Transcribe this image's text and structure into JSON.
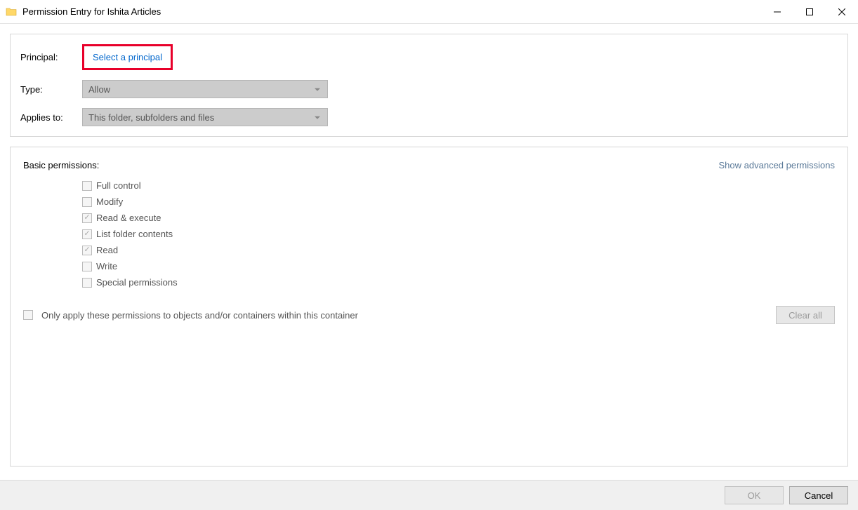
{
  "window": {
    "title": "Permission Entry for Ishita Articles"
  },
  "form": {
    "principal_label": "Principal:",
    "principal_link": "Select a principal",
    "type_label": "Type:",
    "type_value": "Allow",
    "applies_label": "Applies to:",
    "applies_value": "This folder, subfolders and files"
  },
  "permissions": {
    "title": "Basic permissions:",
    "advanced_link": "Show advanced permissions",
    "items": [
      {
        "label": "Full control",
        "checked": false
      },
      {
        "label": "Modify",
        "checked": false
      },
      {
        "label": "Read & execute",
        "checked": true
      },
      {
        "label": "List folder contents",
        "checked": true
      },
      {
        "label": "Read",
        "checked": true
      },
      {
        "label": "Write",
        "checked": false
      },
      {
        "label": "Special permissions",
        "checked": false
      }
    ],
    "apply_only_label": "Only apply these permissions to objects and/or containers within this container",
    "clear_all": "Clear all"
  },
  "footer": {
    "ok": "OK",
    "cancel": "Cancel"
  }
}
